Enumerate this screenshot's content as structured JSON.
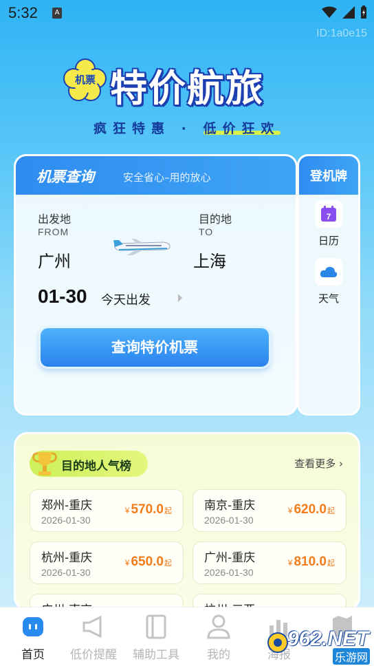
{
  "status_bar": {
    "time": "5:32",
    "notif_letter": "A"
  },
  "id_tag": "ID:1a0e15",
  "hero": {
    "badge": "机票",
    "title": "特价航旅",
    "subtitle": "疯狂特惠 · 低价狂欢"
  },
  "search": {
    "title": "机票查询",
    "subtitle": "安全省心–用的放心",
    "from_label": "出发地",
    "from_en": "FROM",
    "from_city": "广州",
    "to_label": "目的地",
    "to_en": "TO",
    "to_city": "上海",
    "date": "01-30",
    "date_note": "今天出发",
    "button": "查询特价机票"
  },
  "side": {
    "title": "登机牌",
    "calendar_day": "7",
    "calendar_label": "日历",
    "weather_label": "天气"
  },
  "ranking": {
    "tag": "目的地人气榜",
    "more": "查看更多 ›",
    "currency": "¥",
    "price_suffix": "起",
    "routes": [
      {
        "name": "郑州-重庆",
        "date": "2026-01-30",
        "price": "570.0"
      },
      {
        "name": "南京-重庆",
        "date": "2026-01-30",
        "price": "620.0"
      },
      {
        "name": "杭州-重庆",
        "date": "2026-01-30",
        "price": "650.0"
      },
      {
        "name": "广州-重庆",
        "date": "2026-01-30",
        "price": "810.0"
      },
      {
        "name": "广州-南京",
        "date": "",
        "price": ""
      },
      {
        "name": "杭州-三亚",
        "date": "",
        "price": ""
      }
    ]
  },
  "tabs": [
    {
      "label": "首页",
      "icon": "home-icon"
    },
    {
      "label": "低价提醒",
      "icon": "megaphone-icon"
    },
    {
      "label": "辅助工具",
      "icon": "tools-icon"
    },
    {
      "label": "我的",
      "icon": "profile-icon"
    },
    {
      "label": "海报",
      "icon": "poster-icon"
    },
    {
      "label": "",
      "icon": "map-icon"
    }
  ],
  "watermark": {
    "text": "962.NET",
    "sub": "乐游网"
  },
  "colors": {
    "primary": "#2e8cf0",
    "price": "#f27b1a",
    "accent": "#d7f24a"
  }
}
